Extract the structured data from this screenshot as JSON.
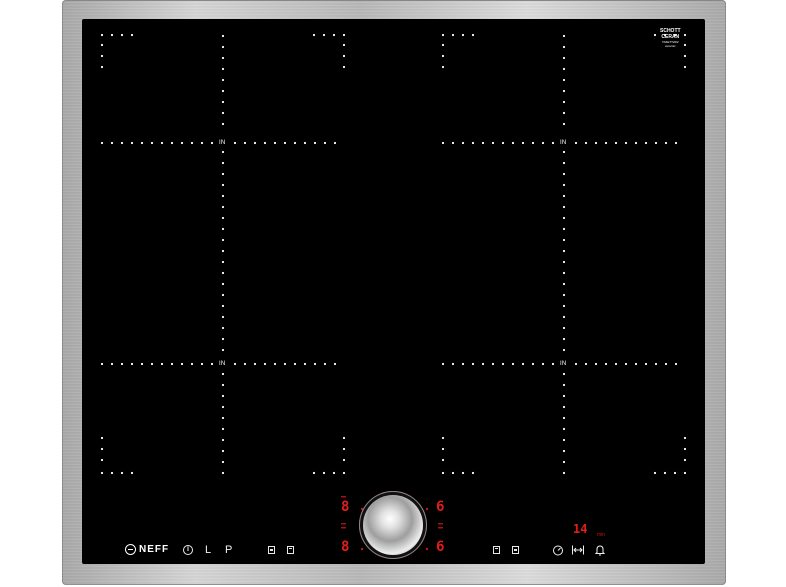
{
  "hob": {
    "zone_label": "IN",
    "glass_brand": {
      "line1": "SCHOTT",
      "line2": "CERAN",
      "line3": "TA6ETT2R2",
      "line4": "ceramic"
    },
    "brand_name": "NEFF",
    "colors": {
      "glass": "#000000",
      "dots": "#ffffff",
      "display": "#e11d1d",
      "frame": "#c0c0c0"
    }
  },
  "controls": {
    "power_icon": "power-icon",
    "lock_label": "L",
    "power_boost_label": "P",
    "left_display_top": "8",
    "left_display_bottom": "8",
    "right_display_top": "6",
    "right_display_bottom": "6",
    "timer_display": "14",
    "timer_unit": "min",
    "icons": [
      "power-icon",
      "lock-icon",
      "powerboost-icon",
      "zone-front-icon",
      "zone-rear-icon",
      "knob",
      "zone-rear-icon",
      "zone-front-icon",
      "timer-icon",
      "cooking-timer-icon",
      "bell-icon"
    ]
  }
}
